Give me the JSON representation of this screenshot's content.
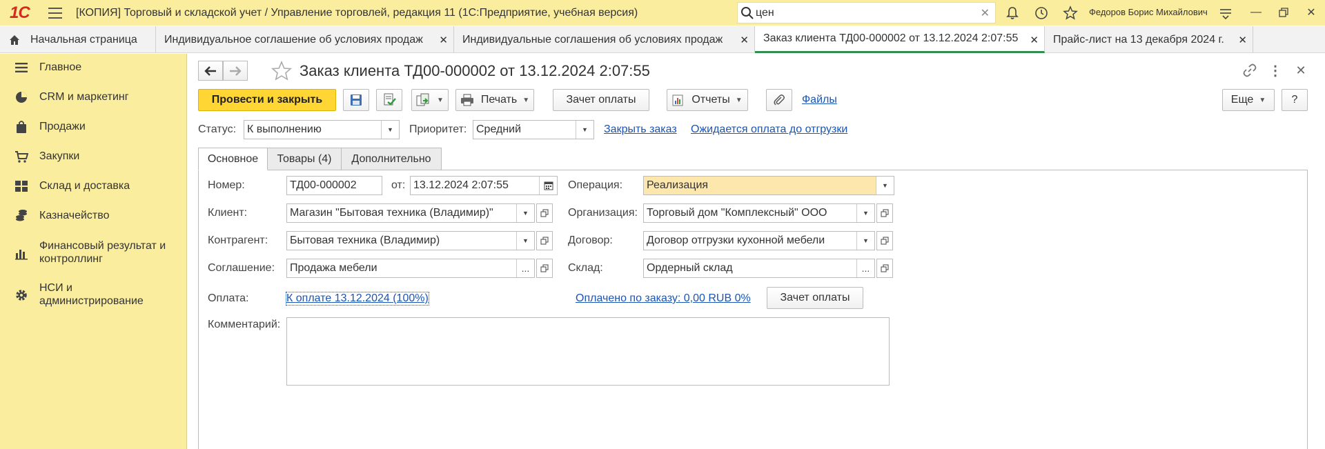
{
  "app": {
    "logo_text": "1С",
    "title": "[КОПИЯ] Торговый и складской учет / Управление торговлей, редакция 11  (1С:Предприятие, учебная версия)",
    "search_value": "цен",
    "user_name": "Федоров Борис Михайлович"
  },
  "tabs": [
    {
      "label": "Начальная страница"
    },
    {
      "label": "Индивидуальное соглашение об условиях продаж"
    },
    {
      "label": "Индивидуальные соглашения об условиях продаж"
    },
    {
      "label": "Заказ клиента ТД00-000002 от 13.12.2024 2:07:55"
    },
    {
      "label": "Прайс-лист на 13 декабря 2024 г."
    }
  ],
  "sidebar": {
    "items": [
      {
        "label": "Главное",
        "icon": "menu-icon"
      },
      {
        "label": "CRM и маркетинг",
        "icon": "pie-chart-icon"
      },
      {
        "label": "Продажи",
        "icon": "shopping-bag-icon"
      },
      {
        "label": "Закупки",
        "icon": "cart-icon"
      },
      {
        "label": "Склад и доставка",
        "icon": "warehouse-icon"
      },
      {
        "label": "Казначейство",
        "icon": "coins-icon"
      },
      {
        "label": "Финансовый результат и контроллинг",
        "icon": "bar-chart-icon"
      },
      {
        "label": "НСИ и администрирование",
        "icon": "gear-icon"
      }
    ]
  },
  "document": {
    "title": "Заказ клиента ТД00-000002 от 13.12.2024 2:07:55"
  },
  "toolbar": {
    "post_close": "Провести и закрыть",
    "print": "Печать",
    "payment_offset": "Зачет оплаты",
    "reports": "Отчеты",
    "files": "Файлы",
    "more": "Еще",
    "help": "?"
  },
  "status_row": {
    "status_label": "Статус:",
    "status_value": "К выполнению",
    "priority_label": "Приоритет:",
    "priority_value": "Средний",
    "close_order_link": "Закрыть заказ",
    "awaiting_payment_link": "Ожидается оплата до отгрузки"
  },
  "form_tabs": [
    {
      "label": "Основное"
    },
    {
      "label": "Товары (4)"
    },
    {
      "label": "Дополнительно"
    }
  ],
  "fields": {
    "number_label": "Номер:",
    "number_value": "ТД00-000002",
    "from_label": "от:",
    "date_value": "13.12.2024  2:07:55",
    "operation_label": "Операция:",
    "operation_value": "Реализация",
    "client_label": "Клиент:",
    "client_value": "Магазин \"Бытовая техника (Владимир)\"",
    "organization_label": "Организация:",
    "organization_value": "Торговый дом \"Комплексный\" ООО",
    "counterparty_label": "Контрагент:",
    "counterparty_value": "Бытовая техника (Владимир)",
    "contract_label": "Договор:",
    "contract_value": "Договор отгрузки кухонной мебели",
    "agreement_label": "Соглашение:",
    "agreement_value": "Продажа мебели",
    "warehouse_label": "Склад:",
    "warehouse_value": "Ордерный склад",
    "payment_label": "Оплата:",
    "payment_link": "К оплате 13.12.2024 (100%)",
    "paid_link": "Оплачено по заказу: 0,00 RUB 0%",
    "payment_offset_button": "Зачет оплаты",
    "comment_label": "Комментарий:",
    "comment_value": ""
  },
  "colors": {
    "sidebar_bg": "#fbed9e",
    "primary_button": "#ffd633",
    "link": "#1a55b3",
    "active_tab_underline": "#2f8f4e",
    "highlight_field": "#fde7ad"
  }
}
